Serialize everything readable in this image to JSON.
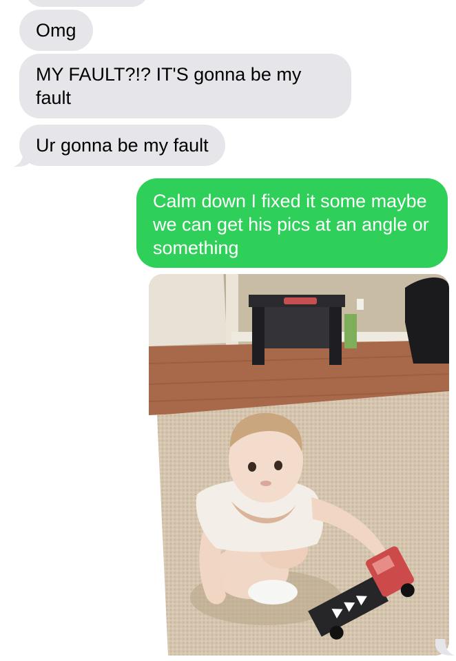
{
  "messages": [
    {
      "id": "omg",
      "direction": "received",
      "text": "Omg"
    },
    {
      "id": "fault",
      "direction": "received",
      "text": "MY FAULT?!? IT'S gonna be my fault"
    },
    {
      "id": "ur",
      "direction": "received",
      "text": "Ur gonna be my fault"
    },
    {
      "id": "calm",
      "direction": "sent",
      "text": "Calm down I fixed it some maybe we can get his pics at an angle or something"
    }
  ],
  "attachment": {
    "type": "photo",
    "subject": "toddler playing with toy truck on rug"
  },
  "colors": {
    "received_bubble": "#e5e5ea",
    "sent_bubble": "#2fd05a",
    "sent_text": "#ffffff",
    "received_text": "#000000"
  }
}
